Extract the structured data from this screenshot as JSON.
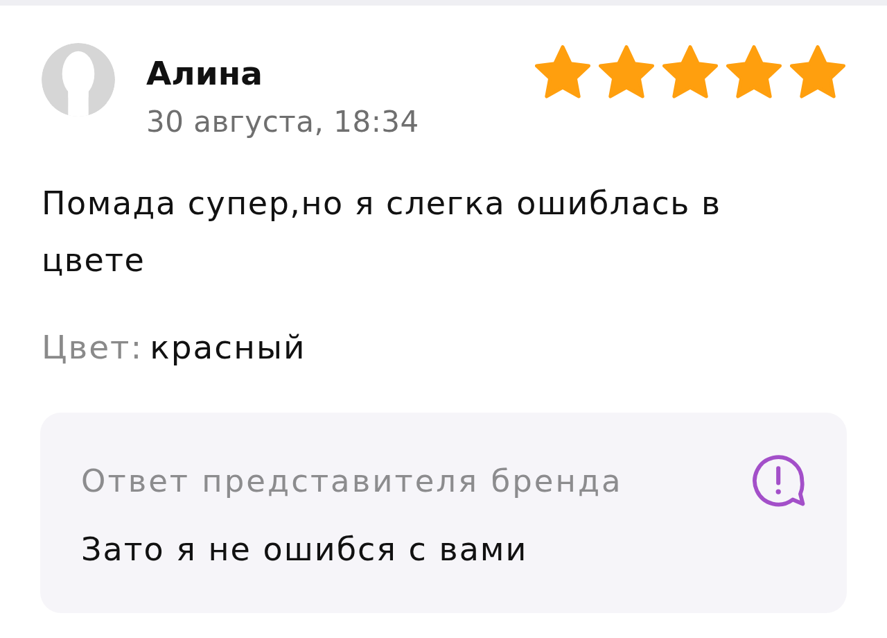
{
  "review": {
    "author": "Алина",
    "date": "30 августа, 18:34",
    "stars": 5,
    "text": "Помада супер,но я слегка ошиблась в цвете",
    "attribute": {
      "label": "Цвет:",
      "value": "красный"
    }
  },
  "brand_reply": {
    "title": "Ответ представителя бренда",
    "text": "Зато я не ошибся с вами"
  }
}
